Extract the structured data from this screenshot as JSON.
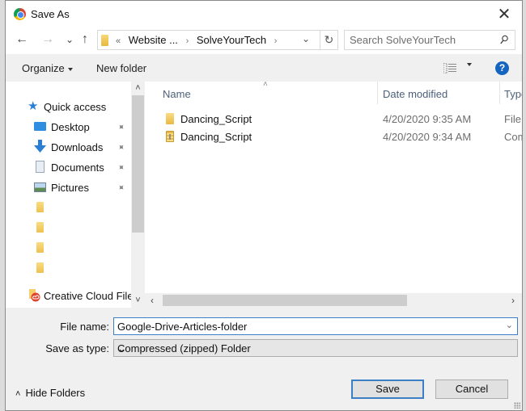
{
  "window": {
    "title": "Save As",
    "close_glyph": "✕"
  },
  "navbar": {
    "back_glyph": "←",
    "forward_glyph": "→",
    "recent_glyph": "⌄",
    "up_glyph": "↑",
    "address": {
      "overflow_glyph": "«",
      "crumbs": [
        "Website ...",
        "SolveYourTech"
      ],
      "separator": "›",
      "dropdown_glyph": "⌄",
      "refresh_glyph": "↻"
    },
    "search": {
      "placeholder": "Search SolveYourTech",
      "value": ""
    }
  },
  "toolbar": {
    "organize_label": "Organize",
    "new_folder_label": "New folder",
    "help_glyph": "?"
  },
  "nav_pane": {
    "items": [
      {
        "label": "Quick access",
        "icon": "star-icon",
        "pinned": false
      },
      {
        "label": "Desktop",
        "icon": "desktop-icon",
        "pinned": true
      },
      {
        "label": "Downloads",
        "icon": "download-icon",
        "pinned": true
      },
      {
        "label": "Documents",
        "icon": "documents-icon",
        "pinned": true
      },
      {
        "label": "Pictures",
        "icon": "pictures-icon",
        "pinned": true
      },
      {
        "label": "",
        "icon": "folder-icon",
        "pinned": false
      },
      {
        "label": "",
        "icon": "folder-icon",
        "pinned": false
      },
      {
        "label": "",
        "icon": "folder-icon",
        "pinned": false
      },
      {
        "label": "",
        "icon": "folder-icon",
        "pinned": false
      },
      {
        "label": "Creative Cloud Files",
        "icon": "creative-cloud-icon",
        "pinned": false
      }
    ],
    "pin_glyph": "📌",
    "scroll_up_glyph": "˄",
    "scroll_down_glyph": "˅"
  },
  "file_list": {
    "columns": [
      "Name",
      "Date modified",
      "Type"
    ],
    "sort_glyph": "˄",
    "rows": [
      {
        "name": "Dancing_Script",
        "date": "4/20/2020 9:35 AM",
        "type": "File",
        "icon": "folder-icon"
      },
      {
        "name": "Dancing_Script",
        "date": "4/20/2020 9:34 AM",
        "type": "Com",
        "icon": "zip-folder-icon"
      }
    ],
    "hscroll_left_glyph": "‹",
    "hscroll_right_glyph": "›"
  },
  "form": {
    "file_name_label": "File name:",
    "file_name_value": "Google-Drive-Articles-folder",
    "save_type_label": "Save as type:",
    "save_type_value": "Compressed (zipped) Folder",
    "chevron_glyph": "⌄"
  },
  "footer": {
    "hide_folders_label": "Hide Folders",
    "hide_folders_glyph": "˄",
    "save_label": "Save",
    "cancel_label": "Cancel"
  }
}
